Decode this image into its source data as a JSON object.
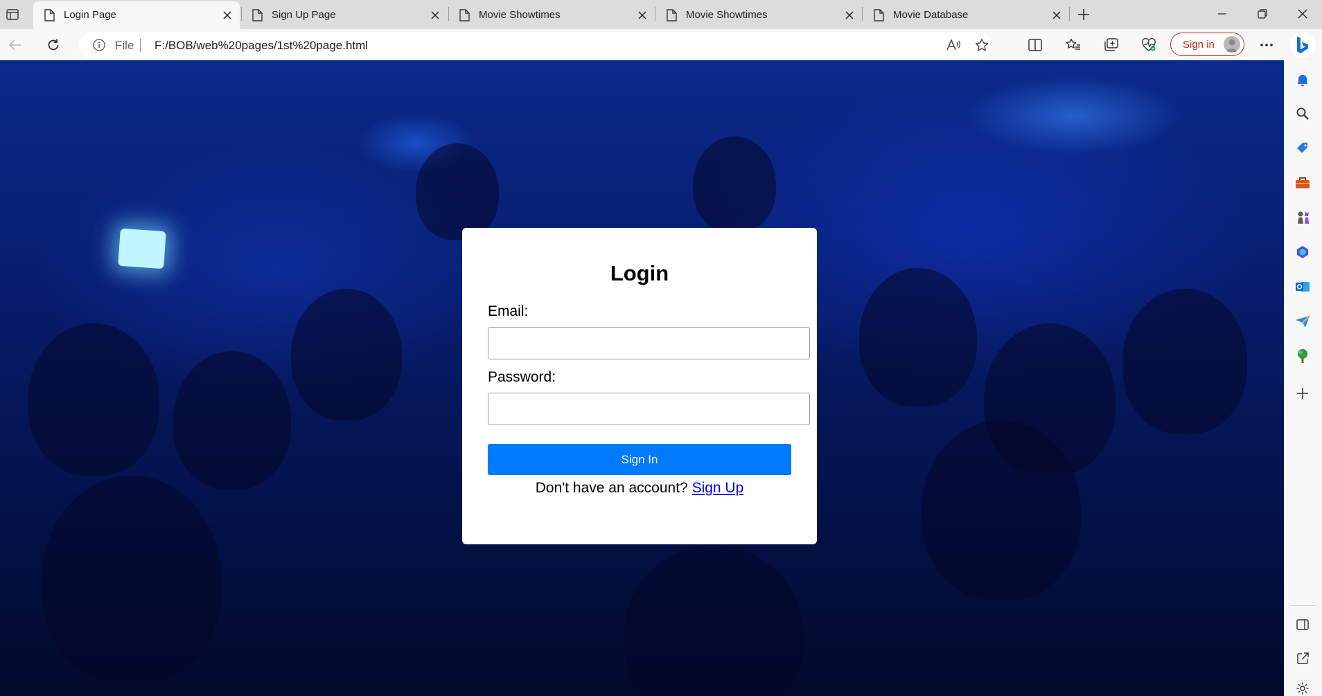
{
  "tabs": [
    {
      "label": "Login Page",
      "active": true
    },
    {
      "label": "Sign Up Page",
      "active": false
    },
    {
      "label": "Movie Showtimes",
      "active": false
    },
    {
      "label": "Movie Showtimes",
      "active": false
    },
    {
      "label": "Movie Database",
      "active": false
    }
  ],
  "address": {
    "scheme_label": "File",
    "url": "F:/BOB/web%20pages/1st%20page.html"
  },
  "toolbar": {
    "signin_label": "Sign in"
  },
  "login": {
    "title": "Login",
    "email_label": "Email:",
    "email_value": "",
    "password_label": "Password:",
    "password_value": "",
    "submit_label": "Sign In",
    "no_account_text": "Don't have an account?",
    "signup_link": "Sign Up"
  },
  "icons": {
    "sidebar": [
      "bell-icon",
      "search-icon",
      "tag-icon",
      "briefcase-icon",
      "chess-icon",
      "copilot-icon",
      "outlook-icon",
      "send-icon",
      "tree-icon",
      "plus-icon",
      "split-screen-icon",
      "external-link-icon",
      "settings-icon"
    ]
  },
  "colors": {
    "primary_button": "#007bff",
    "signin_accent": "#c42b1c",
    "link": "#0000ee"
  }
}
